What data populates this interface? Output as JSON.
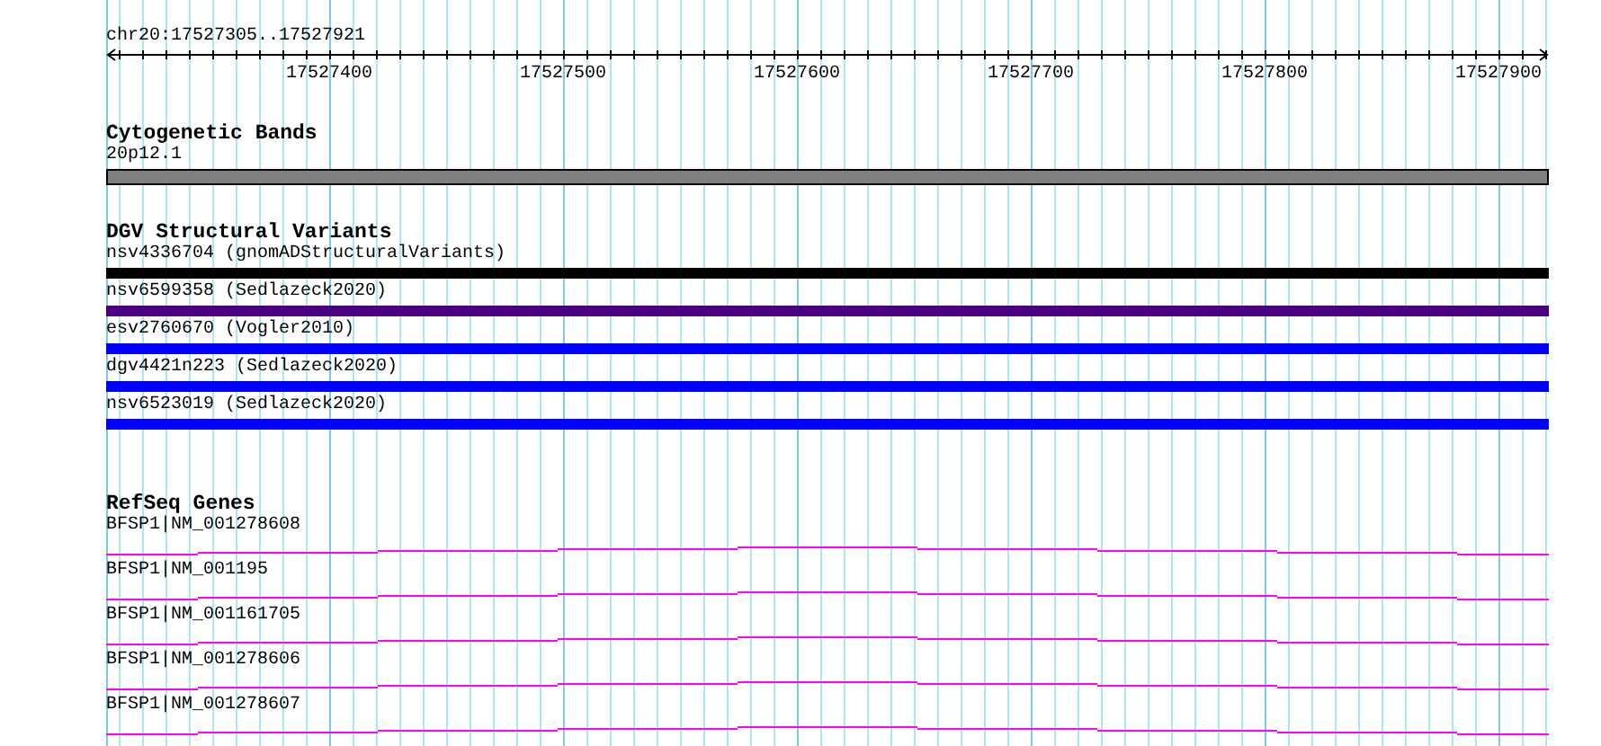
{
  "location": "chr20:17527305..17527921",
  "ruler": {
    "ticks": [
      "17527400",
      "17527500",
      "17527600",
      "17527700",
      "17527800",
      "17527900"
    ]
  },
  "tracks": [
    {
      "title": "Cytogenetic Bands",
      "kind": "band",
      "features": [
        {
          "label": "20p12.1",
          "color": "#808080"
        }
      ]
    },
    {
      "title": "DGV Structural Variants",
      "kind": "bar",
      "features": [
        {
          "label": "nsv4336704 (gnomADStructuralVariants)",
          "color": "#000000"
        },
        {
          "label": "nsv6599358 (Sedlazeck2020)",
          "color": "#4b0082"
        },
        {
          "label": "esv2760670 (Vogler2010)",
          "color": "#0000ff"
        },
        {
          "label": "dgv4421n223 (Sedlazeck2020)",
          "color": "#0000ff"
        },
        {
          "label": "nsv6523019 (Sedlazeck2020)",
          "color": "#0000ff"
        }
      ]
    },
    {
      "title": "RefSeq Genes",
      "kind": "gene",
      "features": [
        {
          "label": "BFSP1|NM_001278608"
        },
        {
          "label": "BFSP1|NM_001195"
        },
        {
          "label": "BFSP1|NM_001161705"
        },
        {
          "label": "BFSP1|NM_001278606"
        },
        {
          "label": "BFSP1|NM_001278607"
        }
      ]
    }
  ]
}
